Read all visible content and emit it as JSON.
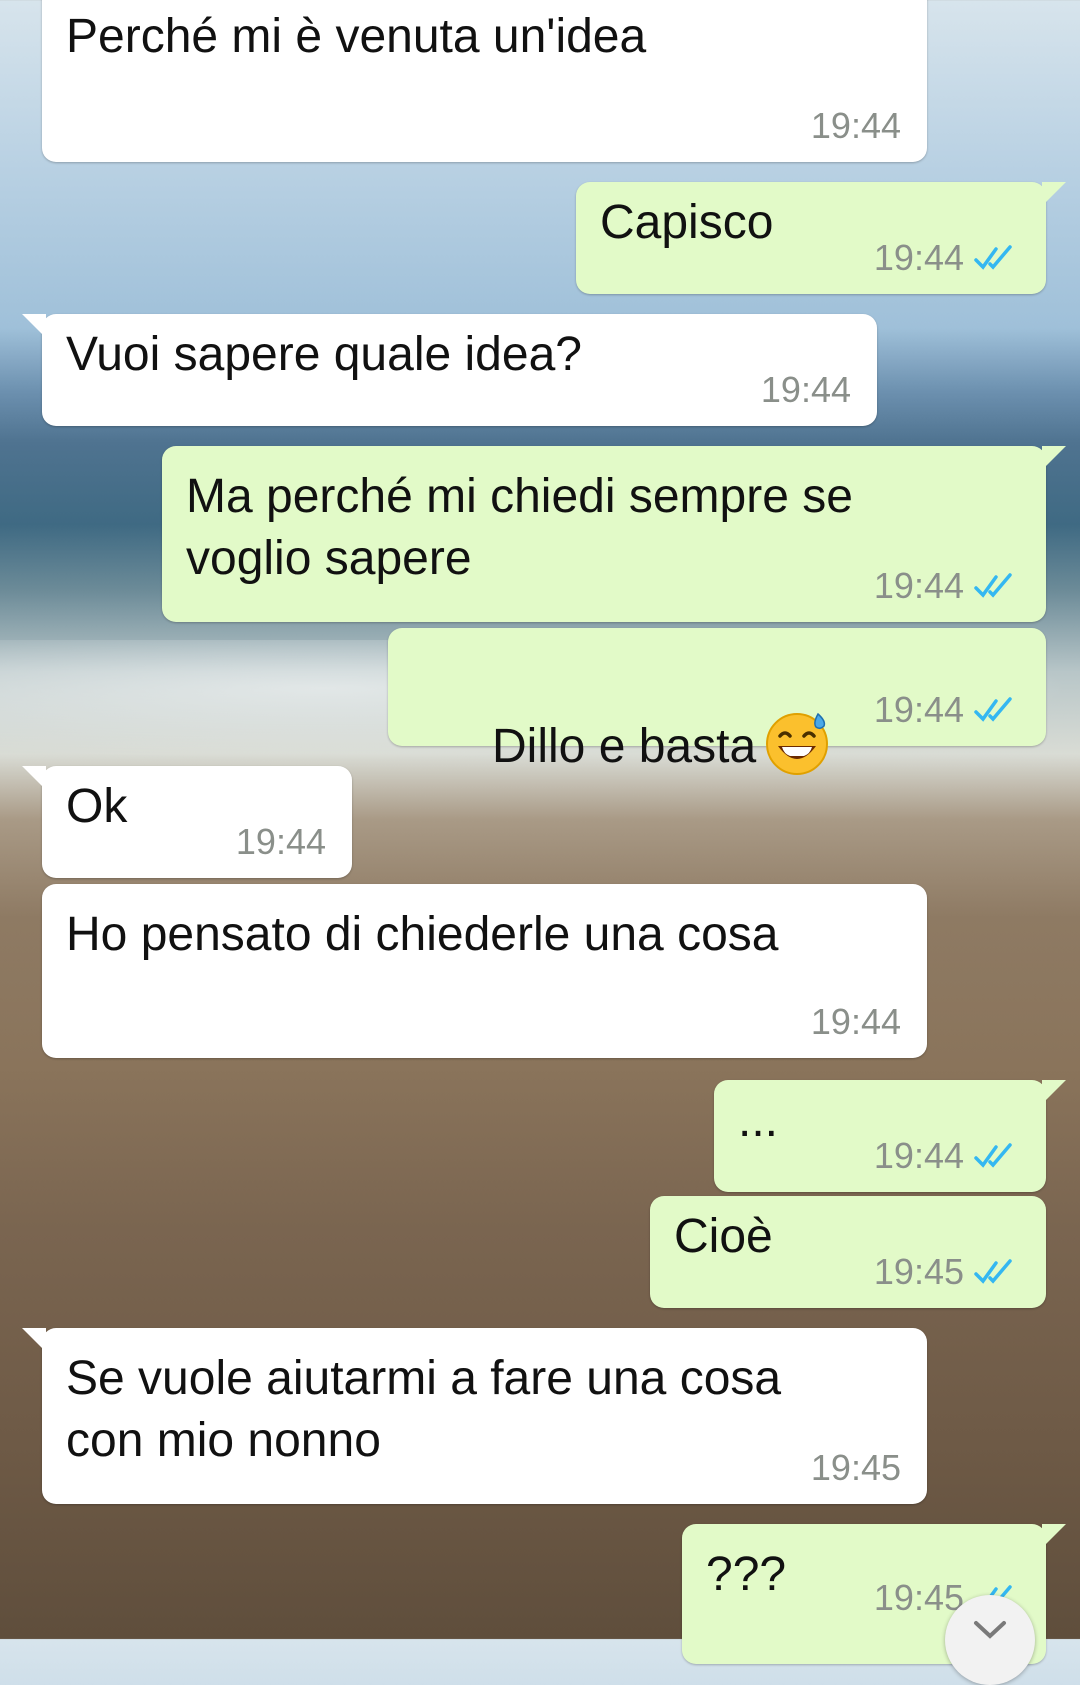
{
  "messages": [
    {
      "id": "m1",
      "direction": "incoming",
      "text": "Perché mi è venuta un'idea",
      "time": "19:44"
    },
    {
      "id": "m2",
      "direction": "outgoing",
      "text": "Capisco",
      "time": "19:44",
      "status": "read"
    },
    {
      "id": "m3",
      "direction": "incoming",
      "text": "Vuoi sapere quale idea?",
      "time": "19:44"
    },
    {
      "id": "m4",
      "direction": "outgoing",
      "text": "Ma perché mi chiedi sempre se\nvoglio sapere",
      "time": "19:44",
      "status": "read"
    },
    {
      "id": "m5",
      "direction": "outgoing",
      "text": "Dillo e basta",
      "emoji": "grinning-face-with-sweat",
      "time": "19:44",
      "status": "read"
    },
    {
      "id": "m6",
      "direction": "incoming",
      "text": "Ok",
      "time": "19:44"
    },
    {
      "id": "m7",
      "direction": "incoming",
      "text": "Ho pensato di chiederle una cosa",
      "time": "19:44"
    },
    {
      "id": "m8",
      "direction": "outgoing",
      "text": "...",
      "time": "19:44",
      "status": "read"
    },
    {
      "id": "m9",
      "direction": "outgoing",
      "text": "Cioè",
      "time": "19:45",
      "status": "read"
    },
    {
      "id": "m10",
      "direction": "incoming",
      "text": "Se vuole aiutarmi a fare una cosa\ncon mio nonno",
      "time": "19:45"
    },
    {
      "id": "m11",
      "direction": "outgoing",
      "text": "???",
      "time": "19:45",
      "status": "read"
    }
  ],
  "colors": {
    "incoming_bubble": "#ffffff",
    "outgoing_bubble": "#e2fac8",
    "timestamp": "#8a8f8a",
    "read_ticks": "#34b7f1"
  },
  "icons": {
    "read_receipt": "double-check-icon",
    "scroll_down": "chevron-down-icon"
  }
}
